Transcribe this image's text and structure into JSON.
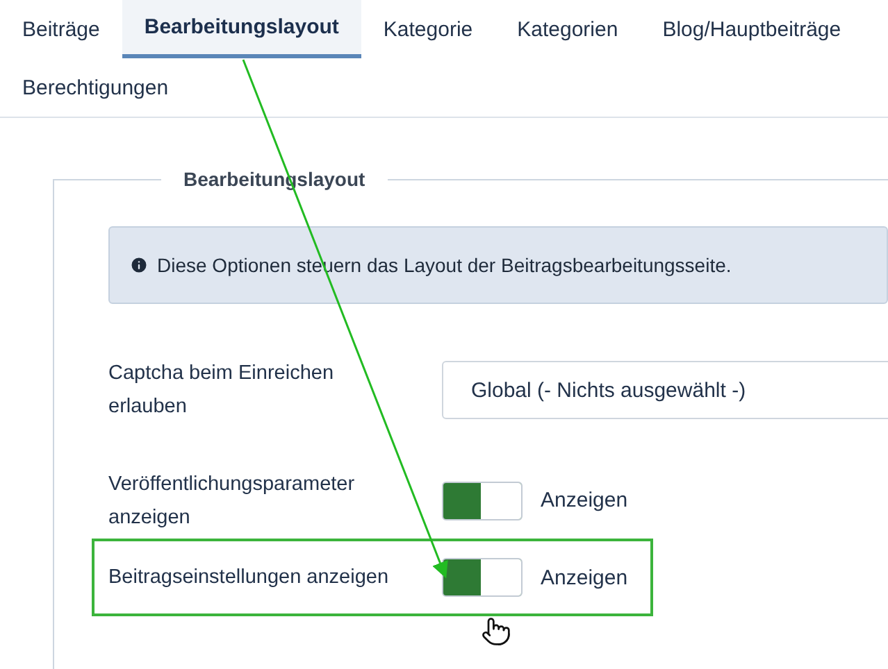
{
  "tabs": [
    {
      "label": "Beiträge",
      "selected": false
    },
    {
      "label": "Bearbeitungslayout",
      "selected": true
    },
    {
      "label": "Kategorie",
      "selected": false
    },
    {
      "label": "Kategorien",
      "selected": false
    },
    {
      "label": "Blog/Hauptbeiträge",
      "selected": false
    },
    {
      "label": "Berechtigungen",
      "selected": false
    }
  ],
  "fieldset": {
    "legend": "Bearbeitungslayout",
    "info": "Diese Optionen steuern das Layout der Beitragsbearbeitungsseite.",
    "fields": [
      {
        "kind": "select",
        "label": "Captcha beim Einreichen erlauben",
        "value": "Global (- Nichts ausgewählt -)",
        "highlighted": false
      },
      {
        "kind": "switch",
        "label": "Veröffentlichungsparameter anzeigen",
        "on": true,
        "state_label": "Anzeigen",
        "highlighted": false
      },
      {
        "kind": "switch",
        "label": "Beitragseinstellungen anzeigen",
        "on": true,
        "state_label": "Anzeigen",
        "highlighted": true
      }
    ]
  }
}
